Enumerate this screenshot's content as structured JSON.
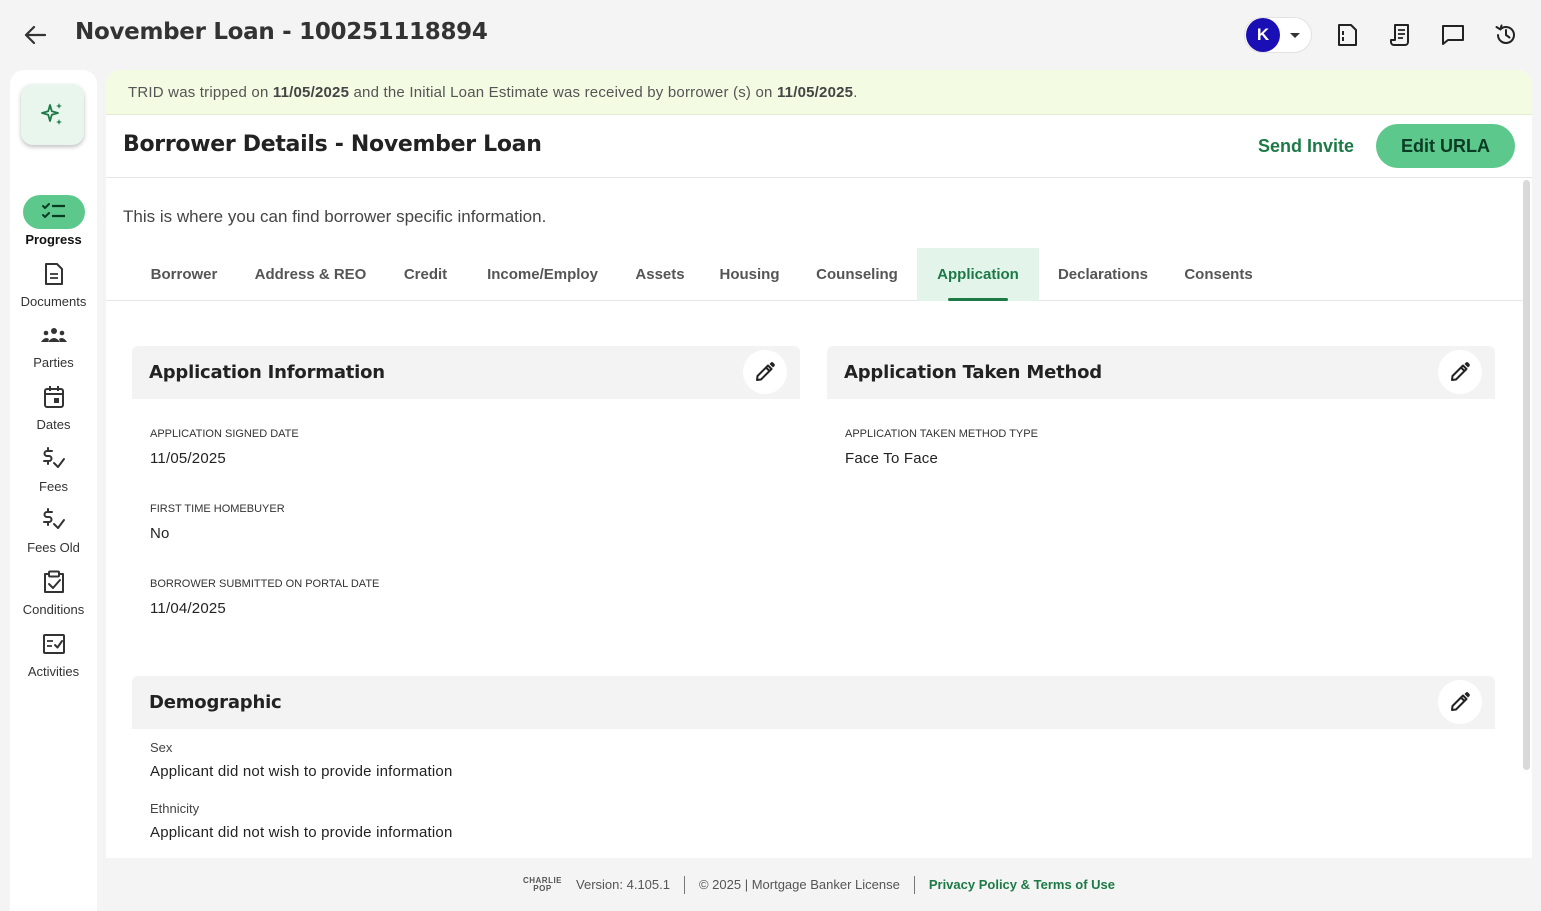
{
  "topbar": {
    "title": "November Loan - 100251118894",
    "user_initial": "K",
    "icons": [
      "back-arrow-icon",
      "document-icon",
      "receipt-icon",
      "chat-icon",
      "history-icon"
    ]
  },
  "sidenav": {
    "items": [
      {
        "label": "Progress",
        "icon": "checklist-icon",
        "active": true
      },
      {
        "label": "Documents",
        "icon": "document-icon"
      },
      {
        "label": "Parties",
        "icon": "people-icon"
      },
      {
        "label": "Dates",
        "icon": "calendar-icon"
      },
      {
        "label": "Fees",
        "icon": "dollar-check-icon"
      },
      {
        "label": "Fees Old",
        "icon": "dollar-check-icon"
      },
      {
        "label": "Conditions",
        "icon": "clipboard-check-icon"
      },
      {
        "label": "Activities",
        "icon": "activity-check-icon"
      }
    ]
  },
  "banner": {
    "prefix": "TRID was tripped on ",
    "trip_date": "11/05/2025",
    "middle": " and the Initial Loan Estimate was received by borrower (s) on ",
    "received_date": "11/05/2025",
    "suffix": "."
  },
  "header": {
    "title": "Borrower Details - November Loan",
    "send_invite": "Send Invite",
    "edit_urla": "Edit URLA"
  },
  "subtitle": "This is where you can find borrower specific information.",
  "tabs": [
    {
      "label": "Borrower"
    },
    {
      "label": "Address & REO"
    },
    {
      "label": "Credit"
    },
    {
      "label": "Income/Employ"
    },
    {
      "label": "Assets"
    },
    {
      "label": "Housing"
    },
    {
      "label": "Counseling"
    },
    {
      "label": "Application",
      "active": true
    },
    {
      "label": "Declarations"
    },
    {
      "label": "Consents"
    }
  ],
  "application_info": {
    "title": "Application Information",
    "signed_date_label": "APPLICATION SIGNED DATE",
    "signed_date": "11/05/2025",
    "first_time_label": "FIRST TIME HOMEBUYER",
    "first_time": "No",
    "portal_date_label": "BORROWER SUBMITTED ON PORTAL DATE",
    "portal_date": "11/04/2025"
  },
  "application_method": {
    "title": "Application Taken Method",
    "type_label": "APPLICATION TAKEN METHOD TYPE",
    "type": "Face To Face"
  },
  "demographic": {
    "title": "Demographic",
    "sex_label": "Sex",
    "sex": "Applicant did not wish to provide information",
    "ethnicity_label": "Ethnicity",
    "ethnicity": "Applicant did not wish to provide information"
  },
  "footer": {
    "logo_top": "CHARLIE",
    "logo_bottom": "POP",
    "version": "Version: 4.105.1",
    "copyright": "© 2025 | Mortgage Banker License",
    "privacy": "Privacy Policy & Terms of Use"
  },
  "colors": {
    "accent": "#5cc88c",
    "accent_dark": "#1d7a47",
    "avatar": "#1a0fb5",
    "banner_bg": "#f4fbe3"
  }
}
